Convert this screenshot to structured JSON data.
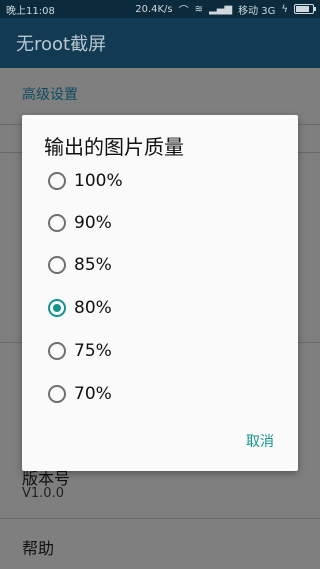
{
  "status_bar": {
    "left_text": "晚上11:08",
    "speed": "20.4K/s",
    "carrier": "移动 3G",
    "icons": [
      "headset-icon",
      "wifi-icon",
      "signal-icon",
      "charging-icon",
      "battery-icon"
    ]
  },
  "app": {
    "title": "无root截屏",
    "section_header": "高级设置",
    "version_title": "版本号",
    "version_value": "V1.0.0",
    "help_title": "帮助"
  },
  "dialog": {
    "title": "输出的图片质量",
    "options": [
      "100%",
      "90%",
      "85%",
      "80%",
      "75%",
      "70%"
    ],
    "selected": "80%",
    "cancel_label": "取消"
  },
  "colors": {
    "accent": "#12948a",
    "appbar": "#123a52",
    "statusbar": "#0b2b3c"
  }
}
